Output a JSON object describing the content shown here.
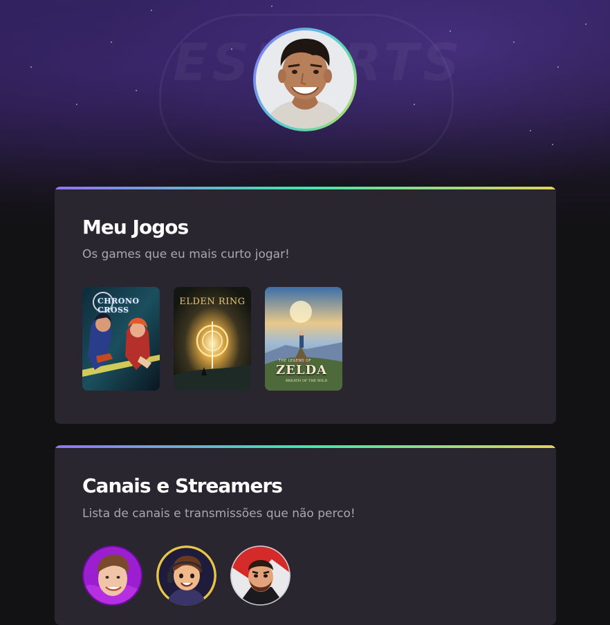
{
  "profile": {
    "avatar_icon": "profile-photo",
    "ring_colors": [
      "#8a6df2",
      "#5ec6e0",
      "#5fd9a0",
      "#e1dc5c"
    ],
    "background_emblem": "ESPORTS"
  },
  "games_section": {
    "title": "Meu Jogos",
    "subtitle": "Os games que eu mais curto jogar!",
    "games": [
      {
        "name": "CHRONO CROSS",
        "icon": "chrono-cross-cover"
      },
      {
        "name": "ELDEN RING",
        "icon": "elden-ring-cover"
      },
      {
        "name": "ZELDA",
        "tagline": "THE LEGEND OF",
        "subtitle": "BREATH OF THE WILD",
        "icon": "zelda-botw-cover"
      }
    ]
  },
  "streamers_section": {
    "title": "Canais e Streamers",
    "subtitle": "Lista de canais e transmissões que não perco!",
    "streamers": [
      {
        "icon": "streamer-avatar-1",
        "accent": "#9b1fd1"
      },
      {
        "icon": "streamer-avatar-2",
        "accent": "#e8c547"
      },
      {
        "icon": "streamer-avatar-3",
        "accent": "#d42a2a"
      }
    ]
  },
  "colors": {
    "page_bg": "#121214",
    "card_bg": "#29262f",
    "gradient": [
      "#9572fc",
      "#43e7ad",
      "#e2d45c"
    ],
    "title": "#ffffff",
    "subtitle": "#a8a8b3"
  }
}
